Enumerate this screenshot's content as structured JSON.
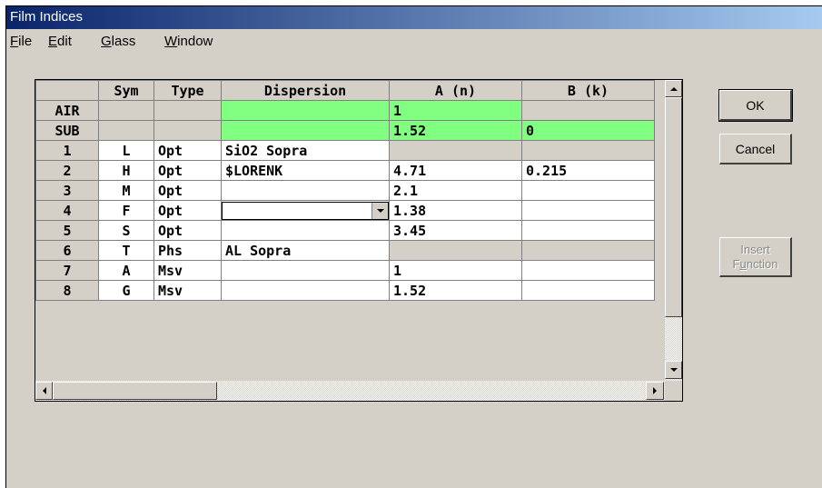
{
  "window": {
    "title": "Film Indices"
  },
  "menu": {
    "items": [
      {
        "acc": "F",
        "rest": "ile"
      },
      {
        "acc": "E",
        "rest": "dit"
      },
      {
        "acc": "G",
        "rest": "lass"
      },
      {
        "acc": "W",
        "rest": "indow"
      }
    ]
  },
  "grid": {
    "headers": [
      "",
      "Sym",
      "Type",
      "Dispersion",
      "A (n)",
      "B (k)"
    ],
    "rows": [
      {
        "label": "AIR",
        "sym": "",
        "type": "",
        "dispersion": "",
        "a": "1",
        "b": ""
      },
      {
        "label": "SUB",
        "sym": "",
        "type": "",
        "dispersion": "",
        "a": "1.52",
        "b": "0"
      },
      {
        "label": "1",
        "sym": "L",
        "type": "Opt",
        "dispersion": "SiO2 Sopra",
        "a": "",
        "b": ""
      },
      {
        "label": "2",
        "sym": "H",
        "type": "Opt",
        "dispersion": "$LORENK",
        "a": "4.71",
        "b": "0.215"
      },
      {
        "label": "3",
        "sym": "M",
        "type": "Opt",
        "dispersion": "",
        "a": "2.1",
        "b": ""
      },
      {
        "label": "4",
        "sym": "F",
        "type": "Opt",
        "dispersion": "",
        "a": "1.38",
        "b": ""
      },
      {
        "label": "5",
        "sym": "S",
        "type": "Opt",
        "dispersion": "",
        "a": "3.45",
        "b": ""
      },
      {
        "label": "6",
        "sym": "T",
        "type": "Phs",
        "dispersion": "AL Sopra",
        "a": "",
        "b": ""
      },
      {
        "label": "7",
        "sym": "A",
        "type": "Msv",
        "dispersion": "",
        "a": "1",
        "b": ""
      },
      {
        "label": "8",
        "sym": "G",
        "type": "Msv",
        "dispersion": "",
        "a": "1.52",
        "b": ""
      }
    ]
  },
  "buttons": {
    "ok": "OK",
    "cancel": "Cancel",
    "insert_line1": "Insert",
    "insert_line2_acc": "u",
    "insert_line2_pre": "F",
    "insert_line2_post": "nction"
  },
  "colors": {
    "highlight_green": "#80ff80",
    "title_start": "#0a246a",
    "title_end": "#a6caf0"
  }
}
